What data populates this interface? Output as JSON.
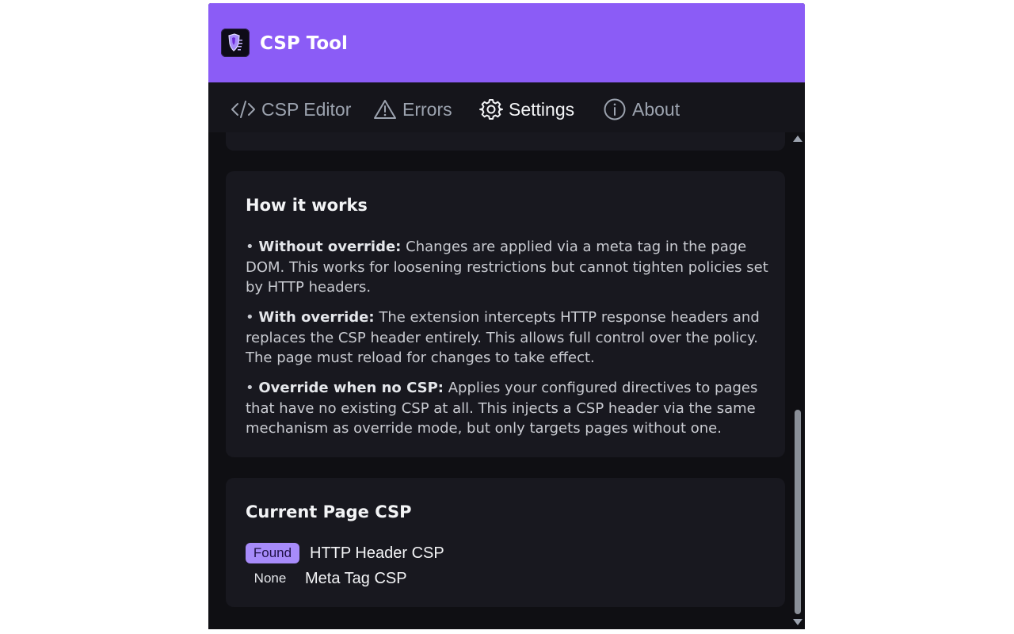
{
  "app": {
    "title": "CSP Tool",
    "icon": "shield-logo-icon"
  },
  "tabs": [
    {
      "label": "CSP Editor",
      "icon": "code-icon",
      "active": false
    },
    {
      "label": "Errors",
      "icon": "warning-icon",
      "active": false
    },
    {
      "label": "Settings",
      "icon": "gear-icon",
      "active": true
    },
    {
      "label": "About",
      "icon": "info-icon",
      "active": false
    }
  ],
  "how_it_works": {
    "title": "How it works",
    "items": [
      {
        "bullet": "•",
        "term": "Without override:",
        "text": "Changes are applied via a meta tag in the page DOM. This works for loosening restrictions but cannot tighten policies set by HTTP headers."
      },
      {
        "bullet": "•",
        "term": "With override:",
        "text": "The extension intercepts HTTP response headers and replaces the CSP header entirely. This allows full control over the policy. The page must reload for changes to take effect."
      },
      {
        "bullet": "•",
        "term": "Override when no CSP:",
        "text": "Applies your configured directives to pages that have no existing CSP at all. This injects a CSP header via the same mechanism as override mode, but only targets pages without one."
      }
    ]
  },
  "current_page_csp": {
    "title": "Current Page CSP",
    "rows": [
      {
        "badge": "Found",
        "label": "HTTP Header CSP"
      },
      {
        "badge": "None",
        "label": "Meta Tag CSP"
      }
    ]
  },
  "colors": {
    "accent": "#8b5cf6",
    "badge_found": "#a78bfa",
    "background": "#0f0f13",
    "card": "#18181f"
  }
}
